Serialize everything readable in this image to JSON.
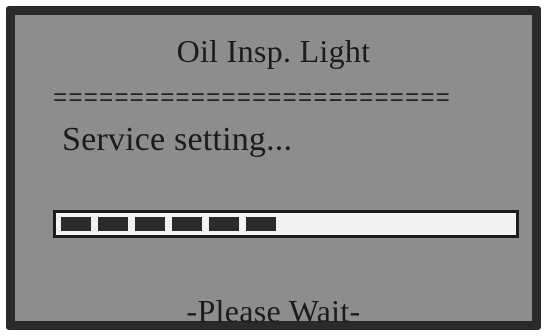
{
  "screen": {
    "title": "Oil Insp. Light",
    "separator": "==========================",
    "status": "Service setting...",
    "progress": {
      "filled_segments": 6,
      "fraction": 0.43
    },
    "footer": "-Please Wait-"
  }
}
